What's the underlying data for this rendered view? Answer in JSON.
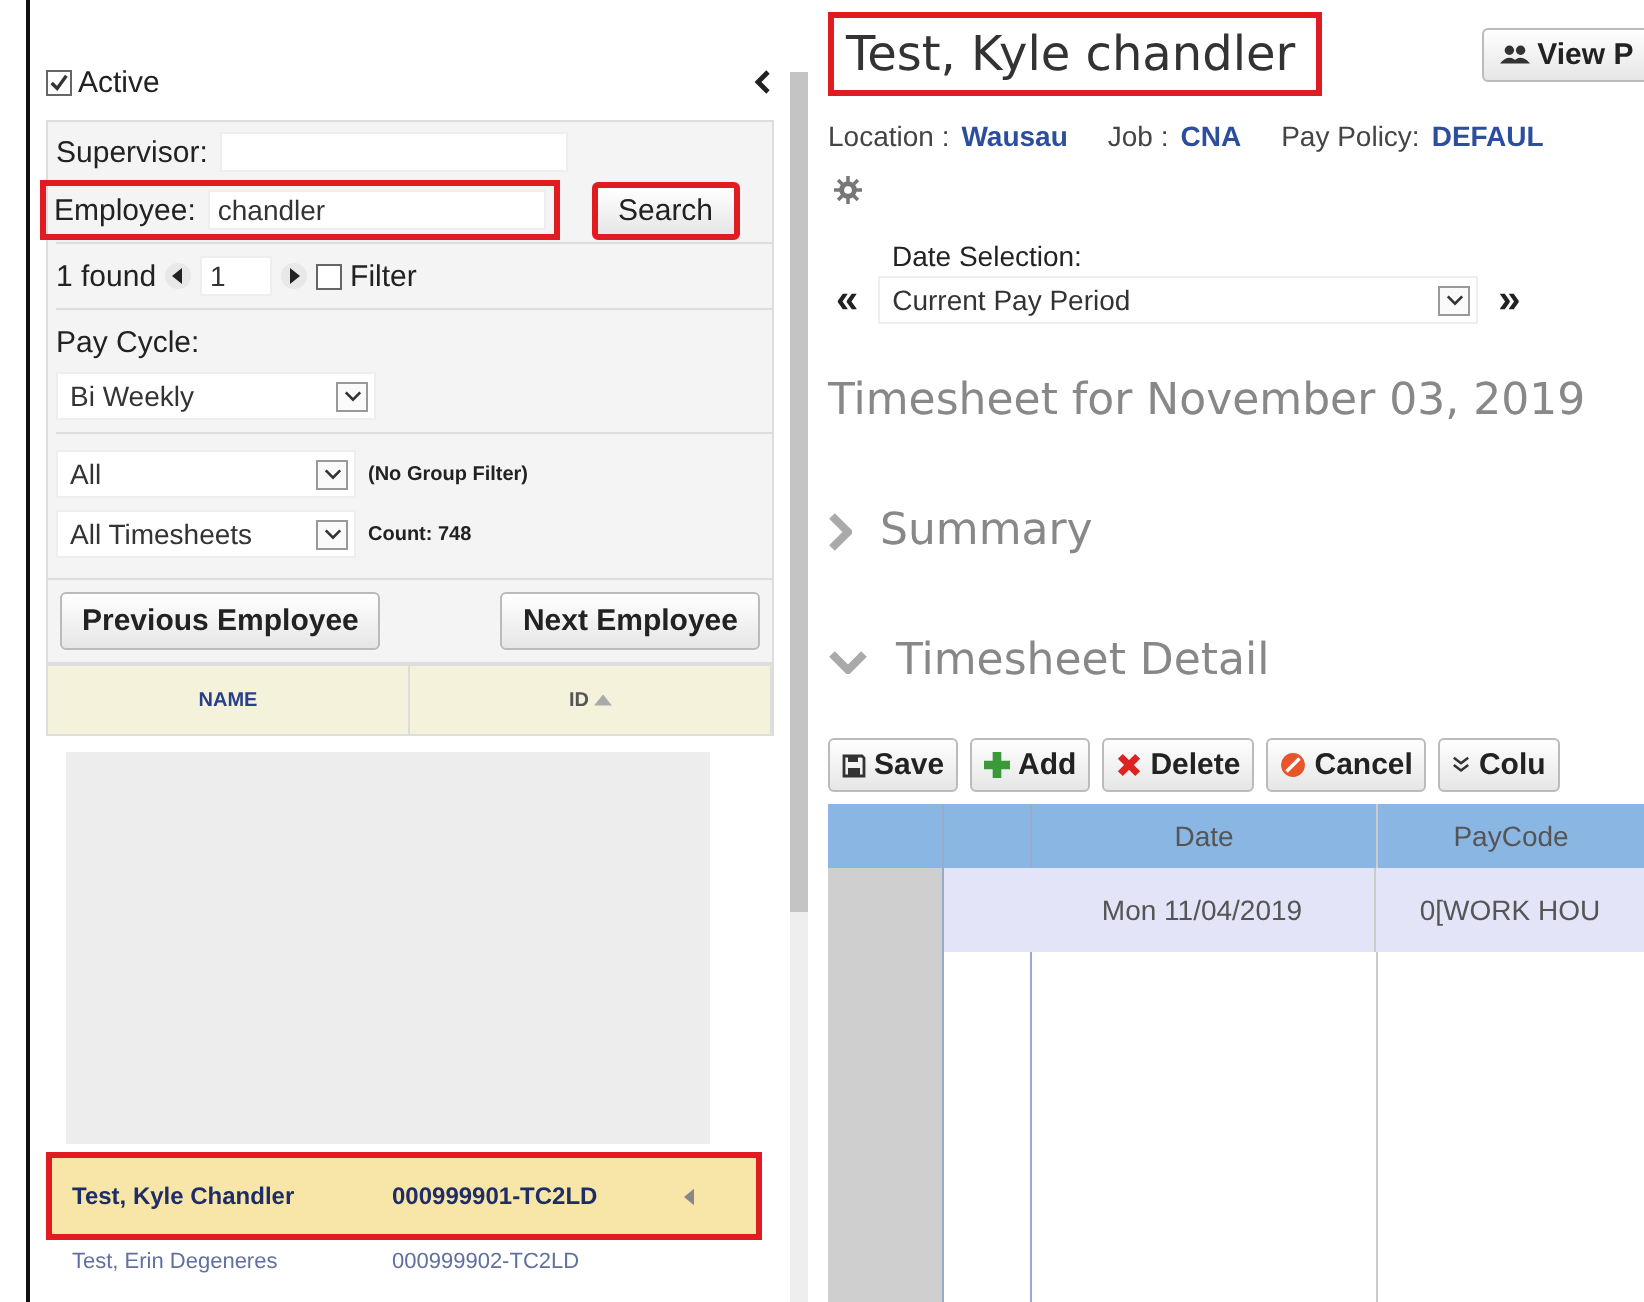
{
  "filters": {
    "active": {
      "label": "Active",
      "checked": true
    },
    "supervisor": {
      "label": "Supervisor:"
    },
    "employee": {
      "label": "Employee:",
      "value": "chandler",
      "highlighted": true
    },
    "search_button": {
      "label": "Search",
      "highlighted": true
    },
    "found": {
      "text": "1 found",
      "page": "1"
    },
    "filter": {
      "label": "Filter",
      "checked": false
    },
    "pay_cycle": {
      "label": "Pay Cycle:",
      "value": "Bi Weekly"
    },
    "group": {
      "value": "All",
      "note": "(No Group Filter)"
    },
    "timesheets": {
      "value": "All Timesheets",
      "count": "Count: 748"
    }
  },
  "nav_buttons": [
    "Previous Employee",
    "Next Employee"
  ],
  "employee_table": {
    "columns": [
      {
        "label": "NAME",
        "sorted": false
      },
      {
        "label": "ID",
        "sorted": true
      }
    ],
    "rows": [
      {
        "name": "Test, Kyle Chandler",
        "id": "000999901-TC2LD",
        "selected": true,
        "highlighted": true
      },
      {
        "name": "Test, Erin Degeneres",
        "id": "000999902-TC2LD",
        "selected": false,
        "highlighted": false
      }
    ]
  },
  "employee": {
    "name": "Test, Kyle chandler",
    "highlighted": true,
    "view_button": "View P",
    "details": [
      {
        "label": "Location :",
        "value": "Wausau"
      },
      {
        "label": "Job :",
        "value": "CNA"
      },
      {
        "label": "Pay Policy:",
        "value": "DEFAUL"
      }
    ]
  },
  "date_selection": {
    "label": "Date Selection:",
    "value": "Current Pay Period",
    "prev": "«",
    "next": "»"
  },
  "timesheet_title": "Timesheet for November 03, 2019",
  "sections": [
    {
      "title": "Summary",
      "expanded": false
    },
    {
      "title": "Timesheet Detail",
      "expanded": true
    }
  ],
  "toolbar": [
    {
      "kind": "save",
      "label": "Save"
    },
    {
      "kind": "add",
      "label": "Add"
    },
    {
      "kind": "delete",
      "label": "Delete"
    },
    {
      "kind": "cancel",
      "label": "Cancel"
    },
    {
      "kind": "columns",
      "label": "Colu"
    }
  ],
  "grid": {
    "columns": [
      "Date",
      "PayCode"
    ],
    "rows": [
      {
        "date": "Mon 11/04/2019",
        "paycode": "0[WORK HOU"
      }
    ]
  }
}
